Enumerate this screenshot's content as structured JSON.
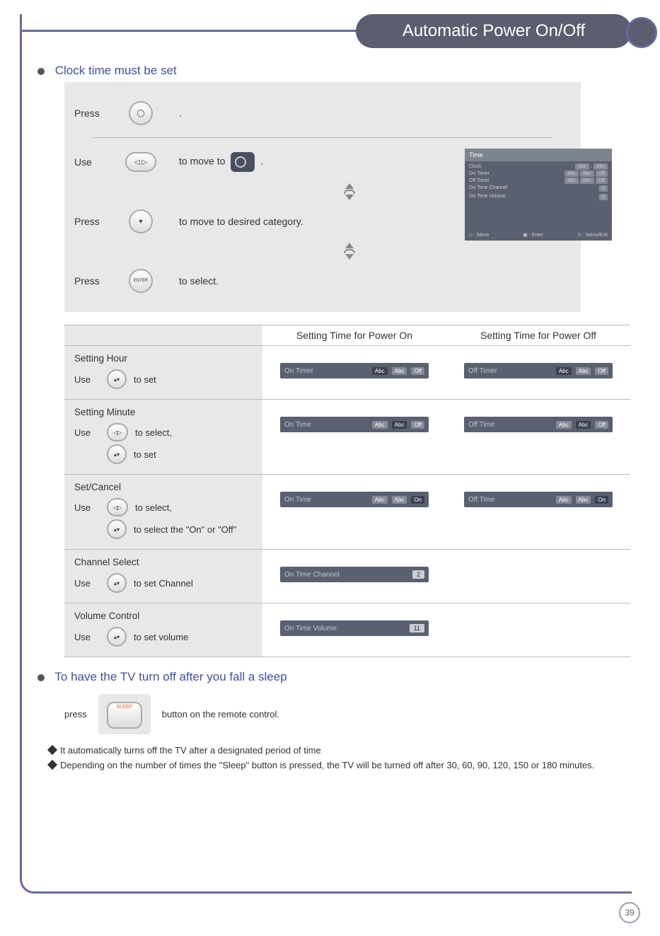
{
  "header": {
    "title": "Automatic Power On/Off"
  },
  "section1": {
    "title": "Clock time must be set"
  },
  "steps": {
    "s1": {
      "label": "Press",
      "text": "."
    },
    "s2": {
      "label": "Use",
      "text_pre": "to move to",
      "text_post": "."
    },
    "s3": {
      "label": "Press",
      "text": "to move to desired category."
    },
    "s4": {
      "label": "Press",
      "text": "to select."
    }
  },
  "thumb": {
    "tab": "Time",
    "rows": {
      "r1": {
        "k": "Clock",
        "a": "Abc",
        "b": "Abc"
      },
      "r2": {
        "k": "On Timer",
        "a": "Abc",
        "b": "Abc",
        "c": "Off"
      },
      "r3": {
        "k": "Off Timer",
        "a": "Abc",
        "b": "Abc",
        "c": "Off"
      },
      "r4": {
        "k": "On Time Channel",
        "v": "0"
      },
      "r5": {
        "k": "On Time Volume",
        "v": "0"
      }
    },
    "foot": {
      "a": "◇ : Move",
      "b": "▣ : Enter",
      "c": "⊙ : Menu/Exit"
    }
  },
  "table": {
    "head": {
      "c1": "",
      "c2": "Setting Time for Power On",
      "c3": "Setting Time for Power Off"
    },
    "r1": {
      "title": "Setting Hour",
      "use": "Use",
      "text": "to set",
      "on": {
        "label": "On Timer",
        "a": "Abc",
        "b": "Abc",
        "c": "Off"
      },
      "off": {
        "label": "Off Timer",
        "a": "Abc",
        "b": "Abc",
        "c": "Off"
      }
    },
    "r2": {
      "title": "Setting Minute",
      "use": "Use",
      "sel": "to select,",
      "set": "to set",
      "on": {
        "label": "On Time",
        "a": "Abc",
        "b": "Abc",
        "c": "Off"
      },
      "off": {
        "label": "Off Time",
        "a": "Abc",
        "b": "Abc",
        "c": "Off"
      }
    },
    "r3": {
      "title": "Set/Cancel",
      "use": "Use",
      "sel": "to select,",
      "set": "to select the \"On\" or \"Off\"",
      "on": {
        "label": "On Time",
        "a": "Abc",
        "b": "Abc",
        "c": "On"
      },
      "off": {
        "label": "Off Time",
        "a": "Abc",
        "b": "Abc",
        "c": "On"
      }
    },
    "r4": {
      "title": "Channel Select",
      "use": "Use",
      "text": "to set Channel",
      "on": {
        "label": "On Time Channel",
        "v": "2"
      }
    },
    "r5": {
      "title": "Volume Control",
      "use": "Use",
      "text": "to set volume",
      "on": {
        "label": "On Time Volume",
        "v": "11"
      }
    }
  },
  "section2": {
    "title": "To have the TV turn off after you fall a sleep"
  },
  "sleep": {
    "press": "press",
    "after": "button on the remote control.",
    "note1": "It automatically turns off the TV after a designated period of time",
    "note2": "Depending on the number of times the \"Sleep\" button is pressed, the TV will be turned off after 30, 60, 90, 120, 150 or 180 minutes.",
    "btn": "SLEEP"
  },
  "pagenum": "39"
}
